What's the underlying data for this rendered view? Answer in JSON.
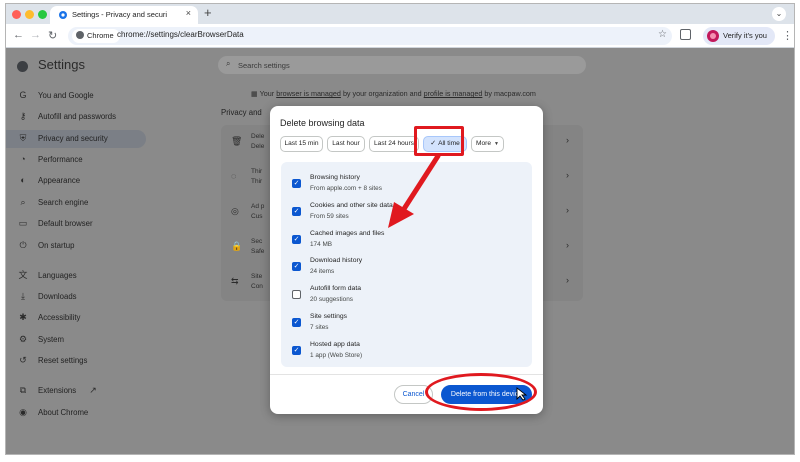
{
  "browser": {
    "tab_title": "Settings - Privacy and securi",
    "tab_close": "×",
    "new_tab": "+",
    "tab_menu": "⌄",
    "site_chip": "Chrome",
    "url": "chrome://settings/clearBrowserData",
    "profile_label": "Verify it's you",
    "accent": "#0b57d0"
  },
  "settings": {
    "title": "Settings",
    "search_placeholder": "Search settings",
    "managed": {
      "prefix": "Your",
      "browser_link": "browser is managed",
      "middle": "by your organization and",
      "profile_link": "profile is managed",
      "suffix": "by macpaw.com"
    },
    "privacy_heading": "Privacy and",
    "sidebar": [
      {
        "label": "You and Google",
        "icon": "google-icon"
      },
      {
        "label": "Autofill and passwords",
        "icon": "key-icon"
      },
      {
        "label": "Privacy and security",
        "icon": "shield-icon",
        "active": true
      },
      {
        "label": "Performance",
        "icon": "speedometer-icon"
      },
      {
        "label": "Appearance",
        "icon": "palette-icon"
      },
      {
        "label": "Search engine",
        "icon": "search-icon"
      },
      {
        "label": "Default browser",
        "icon": "browser-icon"
      },
      {
        "label": "On startup",
        "icon": "power-icon"
      },
      {
        "label": "Languages",
        "icon": "translate-icon"
      },
      {
        "label": "Downloads",
        "icon": "download-icon"
      },
      {
        "label": "Accessibility",
        "icon": "accessibility-icon"
      },
      {
        "label": "System",
        "icon": "wrench-icon"
      },
      {
        "label": "Reset settings",
        "icon": "reset-icon"
      },
      {
        "label": "Extensions",
        "icon": "puzzle-icon"
      },
      {
        "label": "About Chrome",
        "icon": "chrome-icon"
      }
    ],
    "privacy_rows": [
      {
        "line1": "Dele",
        "line2": "Dele"
      },
      {
        "line1": "Thir",
        "line2": "Thir"
      },
      {
        "line1": "Ad p",
        "line2": "Cus"
      },
      {
        "line1": "Sec",
        "line2": "Safe"
      },
      {
        "line1": "Site",
        "line2": "Con"
      }
    ]
  },
  "dialog": {
    "title": "Delete browsing data",
    "time_ranges": [
      "Last 15 min",
      "Last hour",
      "Last 24 hours",
      "All time",
      "More"
    ],
    "selected_range": "All time",
    "options": [
      {
        "title": "Browsing history",
        "subtitle": "From apple.com + 8 sites",
        "checked": true
      },
      {
        "title": "Cookies and other site data",
        "subtitle": "From 59 sites",
        "checked": true
      },
      {
        "title": "Cached images and files",
        "subtitle": "174 MB",
        "checked": true
      },
      {
        "title": "Download history",
        "subtitle": "24 items",
        "checked": true
      },
      {
        "title": "Autofill form data",
        "subtitle": "20 suggestions",
        "checked": false
      },
      {
        "title": "Site settings",
        "subtitle": "7 sites",
        "checked": true
      },
      {
        "title": "Hosted app data",
        "subtitle": "1 app (Web Store)",
        "checked": true
      }
    ],
    "cancel_label": "Cancel",
    "delete_label": "Delete from this device"
  },
  "annotation_color": "#e0191f"
}
